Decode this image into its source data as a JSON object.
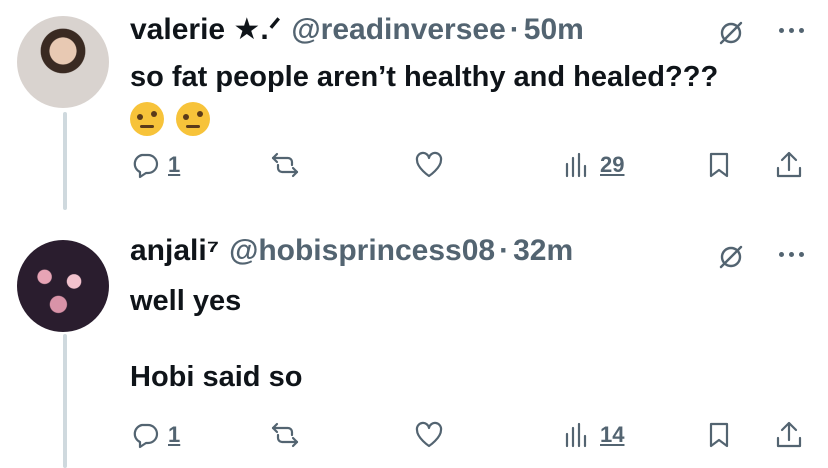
{
  "tweets": [
    {
      "name": "valerie ★.ᐟ",
      "handle": "@readinversee",
      "separator": "·",
      "time": "50m",
      "text": "so fat people aren’t healthy and healed???",
      "emojis": [
        "raised-eyebrow-emoji",
        "raised-eyebrow-emoji"
      ],
      "replies": "1",
      "views": "29"
    },
    {
      "name": "anjali⁷",
      "handle": "@hobisprincess08",
      "separator": "·",
      "time": "32m",
      "text": "well yes\n\nHobi said so",
      "replies": "1",
      "views": "14"
    }
  ],
  "colors": {
    "text": "#0f1419",
    "secondary": "#536471",
    "thread_line": "#cfd9de",
    "background": "#ffffff"
  }
}
